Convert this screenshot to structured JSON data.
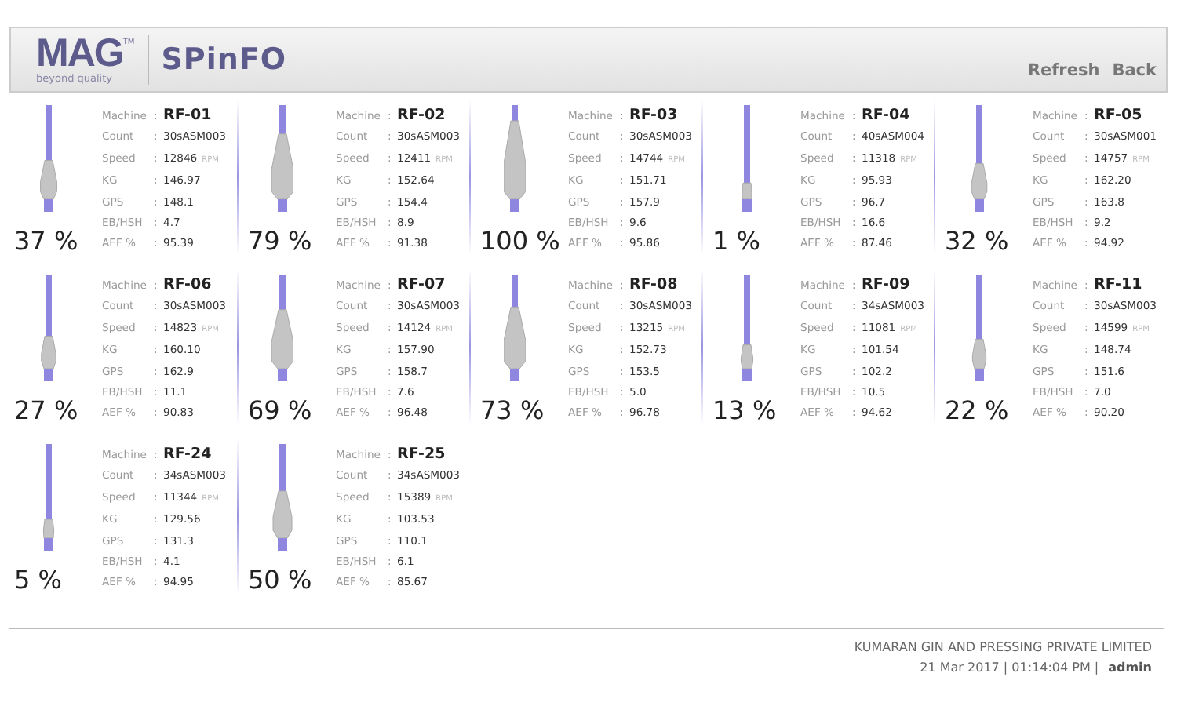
{
  "header": {
    "logo": "MAG",
    "logo_mark": "TM",
    "tagline": "beyond quality",
    "app_name": "SPinFO",
    "links": [
      "Refresh",
      "Back"
    ]
  },
  "machines": [
    {
      "percent": "37 %",
      "fields": [
        {
          "label": "Machine",
          "sep": ":",
          "value": "RF-01"
        },
        {
          "label": "Count",
          "sep": ":",
          "value": "30sASM003"
        },
        {
          "label": "Speed",
          "sep": ":",
          "value": "12846",
          "unit": "RPM"
        },
        {
          "label": "KG",
          "sep": ":",
          "value": "146.97"
        },
        {
          "label": "GPS",
          "sep": ":",
          "value": "148.1"
        },
        {
          "label": "EB/HSH",
          "sep": ":",
          "value": "4.7"
        },
        {
          "label": "AEF %",
          "sep": ":",
          "value": "95.39"
        }
      ]
    },
    {
      "percent": "79 %",
      "fields": [
        {
          "label": "Machine",
          "sep": ":",
          "value": "RF-02"
        },
        {
          "label": "Count",
          "sep": ":",
          "value": "30sASM003"
        },
        {
          "label": "Speed",
          "sep": ":",
          "value": "12411",
          "unit": "RPM"
        },
        {
          "label": "KG",
          "sep": ":",
          "value": "152.64"
        },
        {
          "label": "GPS",
          "sep": ":",
          "value": "154.4"
        },
        {
          "label": "EB/HSH",
          "sep": ":",
          "value": "8.9"
        },
        {
          "label": "AEF %",
          "sep": ":",
          "value": "91.38"
        }
      ]
    },
    {
      "percent": "100 %",
      "fields": [
        {
          "label": "Machine",
          "sep": ":",
          "value": "RF-03"
        },
        {
          "label": "Count",
          "sep": ":",
          "value": "30sASM003"
        },
        {
          "label": "Speed",
          "sep": ":",
          "value": "14744",
          "unit": "RPM"
        },
        {
          "label": "KG",
          "sep": ":",
          "value": "151.71"
        },
        {
          "label": "GPS",
          "sep": ":",
          "value": "157.9"
        },
        {
          "label": "EB/HSH",
          "sep": ":",
          "value": "9.6"
        },
        {
          "label": "AEF %",
          "sep": ":",
          "value": "95.86"
        }
      ]
    },
    {
      "percent": "1 %",
      "fields": [
        {
          "label": "Machine",
          "sep": ":",
          "value": "RF-04"
        },
        {
          "label": "Count",
          "sep": ":",
          "value": "40sASM004"
        },
        {
          "label": "Speed",
          "sep": ":",
          "value": "11318",
          "unit": "RPM"
        },
        {
          "label": "KG",
          "sep": ":",
          "value": "95.93"
        },
        {
          "label": "GPS",
          "sep": ":",
          "value": "96.7"
        },
        {
          "label": "EB/HSH",
          "sep": ":",
          "value": "16.6"
        },
        {
          "label": "AEF %",
          "sep": ":",
          "value": "87.46"
        }
      ]
    },
    {
      "percent": "32 %",
      "fields": [
        {
          "label": "Machine",
          "sep": ":",
          "value": "RF-05"
        },
        {
          "label": "Count",
          "sep": ":",
          "value": "30sASM001"
        },
        {
          "label": "Speed",
          "sep": ":",
          "value": "14757",
          "unit": "RPM"
        },
        {
          "label": "KG",
          "sep": ":",
          "value": "162.20"
        },
        {
          "label": "GPS",
          "sep": ":",
          "value": "163.8"
        },
        {
          "label": "EB/HSH",
          "sep": ":",
          "value": "9.2"
        },
        {
          "label": "AEF %",
          "sep": ":",
          "value": "94.92"
        }
      ]
    },
    {
      "percent": "27 %",
      "fields": [
        {
          "label": "Machine",
          "sep": ":",
          "value": "RF-06"
        },
        {
          "label": "Count",
          "sep": ":",
          "value": "30sASM003"
        },
        {
          "label": "Speed",
          "sep": ":",
          "value": "14823",
          "unit": "RPM"
        },
        {
          "label": "KG",
          "sep": ":",
          "value": "160.10"
        },
        {
          "label": "GPS",
          "sep": ":",
          "value": "162.9"
        },
        {
          "label": "EB/HSH",
          "sep": ":",
          "value": "11.1"
        },
        {
          "label": "AEF %",
          "sep": ":",
          "value": "90.83"
        }
      ]
    },
    {
      "percent": "69 %",
      "fields": [
        {
          "label": "Machine",
          "sep": ":",
          "value": "RF-07"
        },
        {
          "label": "Count",
          "sep": ":",
          "value": "30sASM003"
        },
        {
          "label": "Speed",
          "sep": ":",
          "value": "14124",
          "unit": "RPM"
        },
        {
          "label": "KG",
          "sep": ":",
          "value": "157.90"
        },
        {
          "label": "GPS",
          "sep": ":",
          "value": "158.7"
        },
        {
          "label": "EB/HSH",
          "sep": ":",
          "value": "7.6"
        },
        {
          "label": "AEF %",
          "sep": ":",
          "value": "96.48"
        }
      ]
    },
    {
      "percent": "73 %",
      "fields": [
        {
          "label": "Machine",
          "sep": ":",
          "value": "RF-08"
        },
        {
          "label": "Count",
          "sep": ":",
          "value": "30sASM003"
        },
        {
          "label": "Speed",
          "sep": ":",
          "value": "13215",
          "unit": "RPM"
        },
        {
          "label": "KG",
          "sep": ":",
          "value": "152.73"
        },
        {
          "label": "GPS",
          "sep": ":",
          "value": "153.5"
        },
        {
          "label": "EB/HSH",
          "sep": ":",
          "value": "5.0"
        },
        {
          "label": "AEF %",
          "sep": ":",
          "value": "96.78"
        }
      ]
    },
    {
      "percent": "13 %",
      "fields": [
        {
          "label": "Machine",
          "sep": ":",
          "value": "RF-09"
        },
        {
          "label": "Count",
          "sep": ":",
          "value": "34sASM003"
        },
        {
          "label": "Speed",
          "sep": ":",
          "value": "11081",
          "unit": "RPM"
        },
        {
          "label": "KG",
          "sep": ":",
          "value": "101.54"
        },
        {
          "label": "GPS",
          "sep": ":",
          "value": "102.2"
        },
        {
          "label": "EB/HSH",
          "sep": ":",
          "value": "10.5"
        },
        {
          "label": "AEF %",
          "sep": ":",
          "value": "94.62"
        }
      ]
    },
    {
      "percent": "22 %",
      "fields": [
        {
          "label": "Machine",
          "sep": ":",
          "value": "RF-11"
        },
        {
          "label": "Count",
          "sep": ":",
          "value": "30sASM003"
        },
        {
          "label": "Speed",
          "sep": ":",
          "value": "14599",
          "unit": "RPM"
        },
        {
          "label": "KG",
          "sep": ":",
          "value": "148.74"
        },
        {
          "label": "GPS",
          "sep": ":",
          "value": "151.6"
        },
        {
          "label": "EB/HSH",
          "sep": ":",
          "value": "7.0"
        },
        {
          "label": "AEF %",
          "sep": ":",
          "value": "90.20"
        }
      ]
    },
    {
      "percent": "5 %",
      "fields": [
        {
          "label": "Machine",
          "sep": ":",
          "value": "RF-24"
        },
        {
          "label": "Count",
          "sep": ":",
          "value": "34sASM003"
        },
        {
          "label": "Speed",
          "sep": ":",
          "value": "11344",
          "unit": "RPM"
        },
        {
          "label": "KG",
          "sep": ":",
          "value": "129.56"
        },
        {
          "label": "GPS",
          "sep": ":",
          "value": "131.3"
        },
        {
          "label": "EB/HSH",
          "sep": ":",
          "value": "4.1"
        },
        {
          "label": "AEF %",
          "sep": ":",
          "value": "94.95"
        }
      ]
    },
    {
      "percent": "50 %",
      "fields": [
        {
          "label": "Machine",
          "sep": ":",
          "value": "RF-25"
        },
        {
          "label": "Count",
          "sep": ":",
          "value": "34sASM003"
        },
        {
          "label": "Speed",
          "sep": ":",
          "value": "15389",
          "unit": "RPM"
        },
        {
          "label": "KG",
          "sep": ":",
          "value": "103.53"
        },
        {
          "label": "GPS",
          "sep": ":",
          "value": "110.1"
        },
        {
          "label": "EB/HSH",
          "sep": ":",
          "value": "6.1"
        },
        {
          "label": "AEF %",
          "sep": ":",
          "value": "85.67"
        }
      ]
    }
  ],
  "footer": {
    "company": "KUMARAN GIN AND PRESSING PRIVATE LIMITED",
    "datetime": "21 Mar 2017 | 01:14:04 PM |",
    "user": "admin"
  }
}
